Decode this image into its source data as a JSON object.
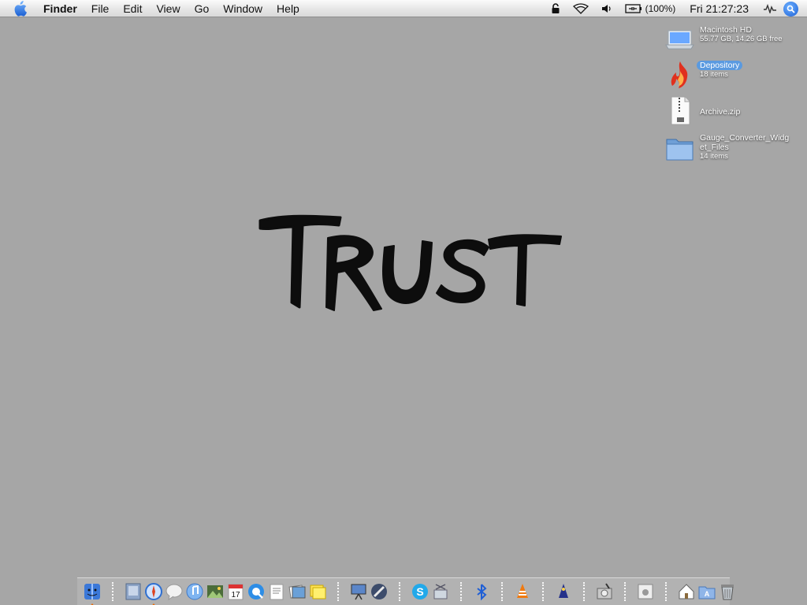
{
  "menubar": {
    "app_name": "Finder",
    "menus": [
      "File",
      "Edit",
      "View",
      "Go",
      "Window",
      "Help"
    ],
    "battery_percent": "(100%)",
    "clock": "Fri 21:27:23",
    "status_icons": [
      "lock-icon",
      "wifi-icon",
      "volume-icon",
      "battery-icon",
      "sync-activity-icon",
      "spotlight-icon"
    ]
  },
  "desktop": {
    "icons": [
      {
        "name": "Macintosh HD",
        "sub": "55.77 GB, 14.26 GB free",
        "icon": "hard-drive-icon",
        "selected": false
      },
      {
        "name": "Depository",
        "sub": "18 items",
        "icon": "flame-icon",
        "selected": true
      },
      {
        "name": "Archive.zip",
        "sub": "",
        "icon": "zip-icon",
        "selected": false
      },
      {
        "name": "Gauge_Converter_Widg\net_Files",
        "sub": "14 items",
        "icon": "folder-icon",
        "selected": false
      }
    ],
    "wallpaper_word": "Trust"
  },
  "dock": {
    "items": [
      "finder-icon",
      "sep",
      "mail-stamp-icon",
      "safari-icon",
      "ichat-icon",
      "itunes-icon",
      "iphoto-icon",
      "ical-icon",
      "quicktime-icon",
      "textedit-icon",
      "preview-icon",
      "stickies-icon",
      "sep",
      "keynote-icon",
      "brush-icon",
      "sep",
      "skype-icon",
      "network-icon",
      "sep",
      "bluetooth-icon",
      "sep",
      "vlc-icon",
      "sep",
      "wizard-icon",
      "sep",
      "disk-utility-icon",
      "sep",
      "apple-box-icon",
      "sep",
      "home-icon",
      "applications-icon",
      "trash-icon"
    ],
    "running": [
      "finder-icon",
      "safari-icon"
    ]
  }
}
